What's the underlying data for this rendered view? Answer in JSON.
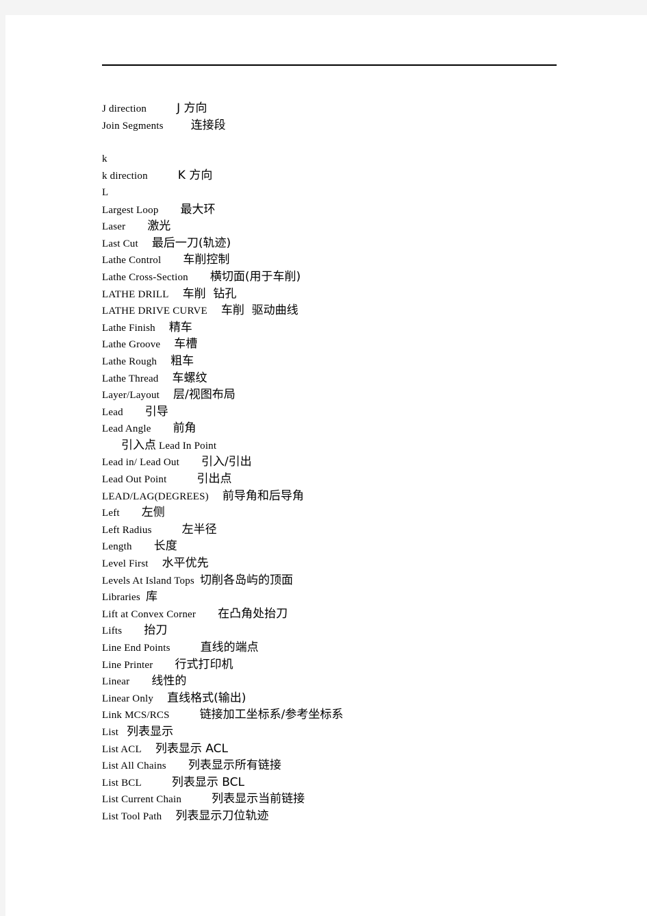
{
  "page": {
    "background_color": "#ffffff",
    "surround_color": "#f4f4f4",
    "rule_color": "#000000"
  },
  "glossary": {
    "description": "English-Chinese CAM/CNC terminology glossary, letters J through L",
    "entries": [
      {
        "en": "J direction",
        "zh": "J 方向",
        "gap": 44,
        "order": "en-first",
        "indent": false
      },
      {
        "en": "Join Segments",
        "zh": "连接段",
        "gap": 40,
        "order": "en-first",
        "indent": false
      },
      {
        "en": "",
        "zh": "",
        "gap": 0,
        "order": "blank",
        "indent": false
      },
      {
        "en": "k",
        "zh": "",
        "gap": 0,
        "order": "en-first",
        "indent": false
      },
      {
        "en": "k direction",
        "zh": "K 方向",
        "gap": 44,
        "order": "en-first",
        "indent": false
      },
      {
        "en": "L",
        "zh": "",
        "gap": 0,
        "order": "en-first",
        "indent": false
      },
      {
        "en": "Largest Loop",
        "zh": "最大环",
        "gap": 32,
        "order": "en-first",
        "indent": false
      },
      {
        "en": "Laser",
        "zh": "激光",
        "gap": 32,
        "order": "en-first",
        "indent": false
      },
      {
        "en": "Last Cut",
        "zh": "最后一刀(轨迹)",
        "gap": 20,
        "order": "en-first",
        "indent": false
      },
      {
        "en": "Lathe Control",
        "zh": "车削控制",
        "gap": 32,
        "order": "en-first",
        "indent": false
      },
      {
        "en": "Lathe Cross-Section",
        "zh": "横切面(用于车削)",
        "gap": 32,
        "order": "en-first",
        "indent": false
      },
      {
        "en": "LATHE DRILL",
        "zh": "车削  钻孔",
        "gap": 20,
        "order": "en-first",
        "indent": false
      },
      {
        "en": "LATHE DRIVE CURVE",
        "zh": "车削  驱动曲线",
        "gap": 20,
        "order": "en-first",
        "indent": false
      },
      {
        "en": "Lathe Finish",
        "zh": "精车",
        "gap": 20,
        "order": "en-first",
        "indent": false
      },
      {
        "en": "Lathe Groove",
        "zh": "车槽",
        "gap": 20,
        "order": "en-first",
        "indent": false
      },
      {
        "en": "Lathe Rough",
        "zh": "粗车",
        "gap": 20,
        "order": "en-first",
        "indent": false
      },
      {
        "en": "Lathe Thread",
        "zh": "车螺纹",
        "gap": 20,
        "order": "en-first",
        "indent": false
      },
      {
        "en": "Layer/Layout",
        "zh": "层/视图布局",
        "gap": 20,
        "order": "en-first",
        "indent": false
      },
      {
        "en": "Lead",
        "zh": "引导",
        "gap": 32,
        "order": "en-first",
        "indent": false
      },
      {
        "en": "Lead Angle",
        "zh": "前角",
        "gap": 32,
        "order": "en-first",
        "indent": false
      },
      {
        "en": "Lead In Point",
        "zh": "引入点",
        "gap": 4,
        "order": "zh-first",
        "indent": true
      },
      {
        "en": "Lead in/ Lead Out",
        "zh": "引入/引出",
        "gap": 32,
        "order": "en-first",
        "indent": false
      },
      {
        "en": "Lead Out Point",
        "zh": "引出点",
        "gap": 44,
        "order": "en-first",
        "indent": false
      },
      {
        "en": "LEAD/LAG(DEGREES)",
        "zh": "前导角和后导角",
        "gap": 20,
        "order": "en-first",
        "indent": false
      },
      {
        "en": "Left",
        "zh": "左侧",
        "gap": 32,
        "order": "en-first",
        "indent": false
      },
      {
        "en": "Left Radius",
        "zh": "左半径",
        "gap": 44,
        "order": "en-first",
        "indent": false
      },
      {
        "en": "Length",
        "zh": "长度",
        "gap": 32,
        "order": "en-first",
        "indent": false
      },
      {
        "en": "Level First",
        "zh": "水平优先",
        "gap": 20,
        "order": "en-first",
        "indent": false
      },
      {
        "en": "Levels At Island Tops",
        "zh": "切削各岛屿的顶面",
        "gap": 8,
        "order": "en-first",
        "indent": false
      },
      {
        "en": "Libraries",
        "zh": "库",
        "gap": 8,
        "order": "en-first",
        "indent": false
      },
      {
        "en": "Lift at Convex Corner",
        "zh": "在凸角处抬刀",
        "gap": 32,
        "order": "en-first",
        "indent": false
      },
      {
        "en": "Lifts",
        "zh": "抬刀",
        "gap": 32,
        "order": "en-first",
        "indent": false
      },
      {
        "en": "Line End Points",
        "zh": "直线的端点",
        "gap": 44,
        "order": "en-first",
        "indent": false
      },
      {
        "en": "Line Printer",
        "zh": "行式打印机",
        "gap": 32,
        "order": "en-first",
        "indent": false
      },
      {
        "en": "Linear",
        "zh": "线性的",
        "gap": 32,
        "order": "en-first",
        "indent": false
      },
      {
        "en": "Linear Only",
        "zh": "直线格式(输出)",
        "gap": 20,
        "order": "en-first",
        "indent": false
      },
      {
        "en": "Link MCS/RCS",
        "zh": "链接加工坐标系/参考坐标系",
        "gap": 44,
        "order": "en-first",
        "indent": false
      },
      {
        "en": "List",
        "zh": "列表显示",
        "gap": 12,
        "order": "en-first",
        "indent": false
      },
      {
        "en": "List ACL",
        "zh": "列表显示 ACL",
        "gap": 20,
        "order": "en-first",
        "indent": false
      },
      {
        "en": "List All Chains",
        "zh": "列表显示所有链接",
        "gap": 32,
        "order": "en-first",
        "indent": false
      },
      {
        "en": "List BCL",
        "zh": "列表显示 BCL",
        "gap": 44,
        "order": "en-first",
        "indent": false
      },
      {
        "en": "List Current Chain",
        "zh": "列表显示当前链接",
        "gap": 44,
        "order": "en-first",
        "indent": false
      },
      {
        "en": "List Tool Path",
        "zh": "列表显示刀位轨迹",
        "gap": 20,
        "order": "en-first",
        "indent": false
      }
    ]
  }
}
